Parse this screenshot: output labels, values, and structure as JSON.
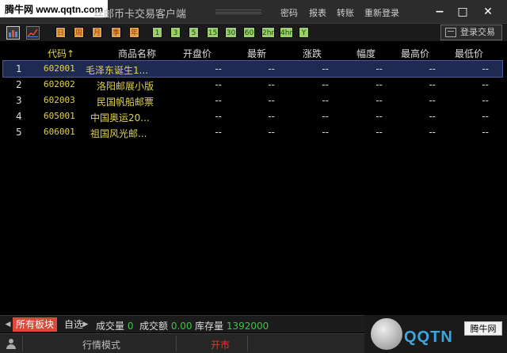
{
  "watermark": "腾牛网 www.qqtn.com",
  "app": {
    "title": "丝邮币卡交易客户端"
  },
  "top_menu": [
    "密码",
    "报表",
    "转账",
    "重新登录"
  ],
  "window_controls": {
    "minimize": "−",
    "maximize": "□",
    "close": "✕"
  },
  "toolbar": {
    "period_buttons": [
      "日",
      "周",
      "月",
      "季",
      "年"
    ],
    "minute_buttons": [
      "1",
      "3",
      "5",
      "15",
      "30",
      "60",
      "2hr",
      "4hr",
      "Y"
    ],
    "login_label": "登录交易"
  },
  "table": {
    "columns": [
      "代码↑",
      "商品名称",
      "开盘价",
      "最新",
      "涨跌",
      "幅度",
      "最高价",
      "最低价"
    ],
    "rows": [
      {
        "idx": "1",
        "code": "602001",
        "name": "毛泽东诞生1...",
        "open": "--",
        "last": "--",
        "chg": "--",
        "pct": "--",
        "high": "--",
        "low": "--"
      },
      {
        "idx": "2",
        "code": "602002",
        "name": "洛阳邮展小版",
        "open": "--",
        "last": "--",
        "chg": "--",
        "pct": "--",
        "high": "--",
        "low": "--"
      },
      {
        "idx": "3",
        "code": "602003",
        "name": "民国帆船邮票",
        "open": "--",
        "last": "--",
        "chg": "--",
        "pct": "--",
        "high": "--",
        "low": "--"
      },
      {
        "idx": "4",
        "code": "605001",
        "name": "中国奥运20...",
        "open": "--",
        "last": "--",
        "chg": "--",
        "pct": "--",
        "high": "--",
        "low": "--"
      },
      {
        "idx": "5",
        "code": "606001",
        "name": "祖国风光邮...",
        "open": "--",
        "last": "--",
        "chg": "--",
        "pct": "--",
        "high": "--",
        "low": "--"
      }
    ]
  },
  "bottom": {
    "tabs": [
      "所有板块",
      "自选"
    ],
    "stats": [
      {
        "label": "成交量",
        "value": "0"
      },
      {
        "label": "成交额",
        "value": "0.00"
      },
      {
        "label": "库存量",
        "value": "1392000"
      }
    ]
  },
  "status": {
    "mode": "行情模式",
    "market": "开市"
  },
  "logo": {
    "text": "QQTN",
    "badge": "腾牛网"
  },
  "colors": {
    "code_yellow": "#e2d44a",
    "value_green": "#3fc14a",
    "active_tab": "#d94a3a",
    "market_red": "#e03a2a"
  }
}
